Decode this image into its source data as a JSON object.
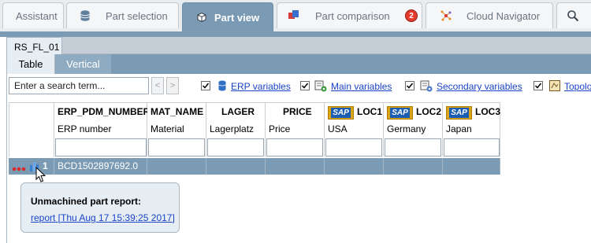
{
  "tabs": [
    {
      "label": "Assistant",
      "icon": "assistant-icon"
    },
    {
      "label": "Part selection",
      "icon": "database-icon"
    },
    {
      "label": "Part view",
      "icon": "cube-icon",
      "active": true
    },
    {
      "label": "Part comparison",
      "icon": "compare-icon",
      "badge": "2"
    },
    {
      "label": "Cloud Navigator",
      "icon": "network-icon"
    },
    {
      "label": "",
      "icon": "search-icon"
    }
  ],
  "workspace": {
    "subtab": "RS_FL_01",
    "view_tabs": [
      "Table",
      "Vertical"
    ]
  },
  "toolbar": {
    "search_placeholder": "Enter a search term...",
    "prev": "<",
    "next": ">",
    "options": [
      {
        "label": "ERP variables",
        "checked": true,
        "icon": "erp-variables-icon"
      },
      {
        "label": "Main variables",
        "checked": true,
        "icon": "main-variables-icon"
      },
      {
        "label": "Secondary variables",
        "checked": true,
        "icon": "secondary-variables-icon"
      },
      {
        "label": "Topolo",
        "checked": true,
        "icon": "topology-icon"
      }
    ]
  },
  "table": {
    "columns": [
      {
        "name": "ERP_PDM_NUMBER",
        "desc": "ERP number"
      },
      {
        "name": "MAT_NAME",
        "desc": "Material"
      },
      {
        "name": "LAGER",
        "desc": "Lagerplatz"
      },
      {
        "name": "PRICE",
        "desc": "Price"
      },
      {
        "name": "LOC1",
        "desc": "USA",
        "sap": true
      },
      {
        "name": "LOC2",
        "desc": "Germany",
        "sap": true
      },
      {
        "name": "LOC3",
        "desc": "Japan",
        "sap": true
      }
    ],
    "sap_label": "SAP",
    "row": {
      "index": "1",
      "erp_number": "BCD1502897692.0"
    }
  },
  "tooltip": {
    "title": "Unmachined part report:",
    "link": "report [Thu Aug 17 15:39:25 2017]"
  },
  "colors": {
    "accent": "#7b9bb4",
    "link": "#1a43c9",
    "badge": "#e53b2f"
  }
}
